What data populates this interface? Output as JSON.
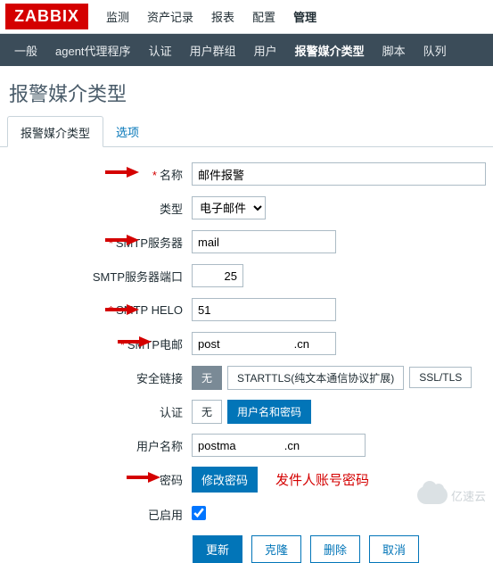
{
  "brand": "ZABBIX",
  "topnav": {
    "items": [
      "监测",
      "资产记录",
      "报表",
      "配置",
      "管理"
    ],
    "active_index": 4
  },
  "subnav": {
    "items": [
      "一般",
      "agent代理程序",
      "认证",
      "用户群组",
      "用户",
      "报警媒介类型",
      "脚本",
      "队列"
    ],
    "active_index": 5
  },
  "page_title": "报警媒介类型",
  "tabs": {
    "items": [
      "报警媒介类型",
      "选项"
    ],
    "active_index": 0
  },
  "form": {
    "name_label": "名称",
    "name_value": "邮件报警",
    "type_label": "类型",
    "type_value": "电子邮件",
    "smtp_server_label": "SMTP服务器",
    "smtp_server_value": "mail",
    "smtp_port_label": "SMTP服务器端口",
    "smtp_port_value": "25",
    "smtp_helo_label": "SMTP HELO",
    "smtp_helo_value": "51",
    "smtp_email_label": "SMTP电邮",
    "smtp_email_value": "post                       .cn",
    "security_label": "安全链接",
    "security_options": [
      "无",
      "STARTTLS(纯文本通信协议扩展)",
      "SSL/TLS"
    ],
    "security_active": 0,
    "auth_label": "认证",
    "auth_options": [
      "无",
      "用户名和密码"
    ],
    "auth_active": 1,
    "username_label": "用户名称",
    "username_value": "postma               .cn",
    "password_label": "密码",
    "password_button": "修改密码",
    "enabled_label": "已启用",
    "enabled_checked": true
  },
  "buttons": {
    "update": "更新",
    "clone": "克隆",
    "delete": "删除",
    "cancel": "取消"
  },
  "annotation": "发件人账号密码",
  "watermark": "亿速云"
}
